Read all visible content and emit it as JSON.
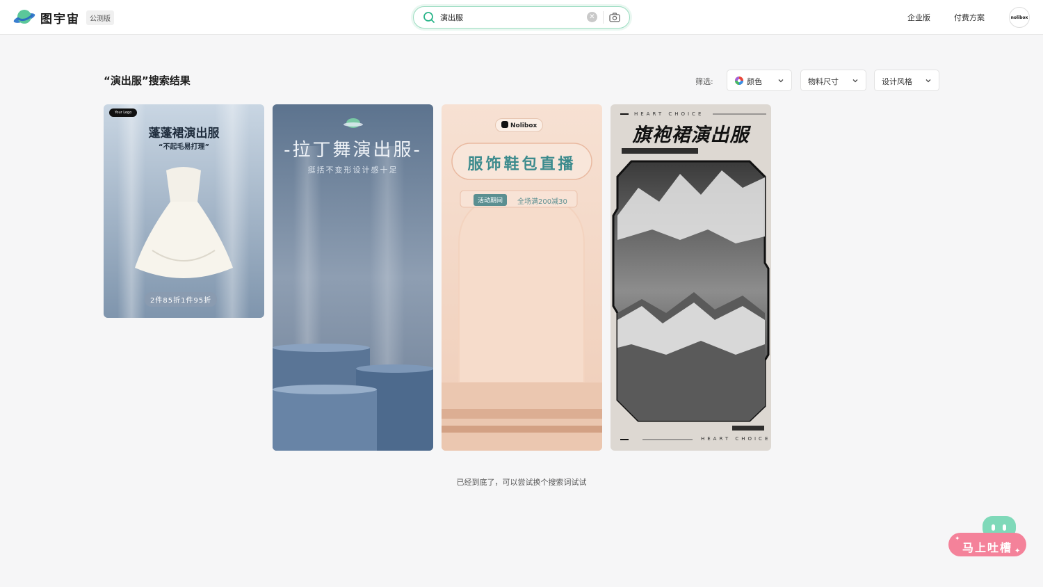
{
  "header": {
    "brand": "图宇宙",
    "beta_badge": "公测版",
    "search_value": "演出服",
    "links": [
      "企业版",
      "付费方案"
    ],
    "avatar_text": "nolibox"
  },
  "results": {
    "title": "“演出服”搜索结果",
    "filter_label": "筛选:",
    "filters": [
      "颜色",
      "物料尺寸",
      "设计风格"
    ]
  },
  "cards": [
    {
      "logo": "Your Logo",
      "title": "蓬蓬裙演出服",
      "subtitle": "“不起毛易打理”",
      "badge": "2件85折1件95折"
    },
    {
      "title": "-拉丁舞演出服-",
      "subtitle": "挺括不变形设计感十足"
    },
    {
      "brand": "Nolibox",
      "title": "服饰鞋包直播",
      "tag": "活动期间",
      "promo": "全场满200减30"
    },
    {
      "top_caption": "HEART CHOICE",
      "title": "旗袍裙演出服",
      "bottom_caption": "HEART CHOICE"
    }
  ],
  "footer": {
    "end_text": "已经到底了，可以尝试换个搜索词试试"
  },
  "feedback": {
    "label": "马上吐槽"
  },
  "colors": {
    "accent": "#9adcc0",
    "feedback_pink": "#f4829a",
    "feedback_mint": "#7fd9b9"
  }
}
